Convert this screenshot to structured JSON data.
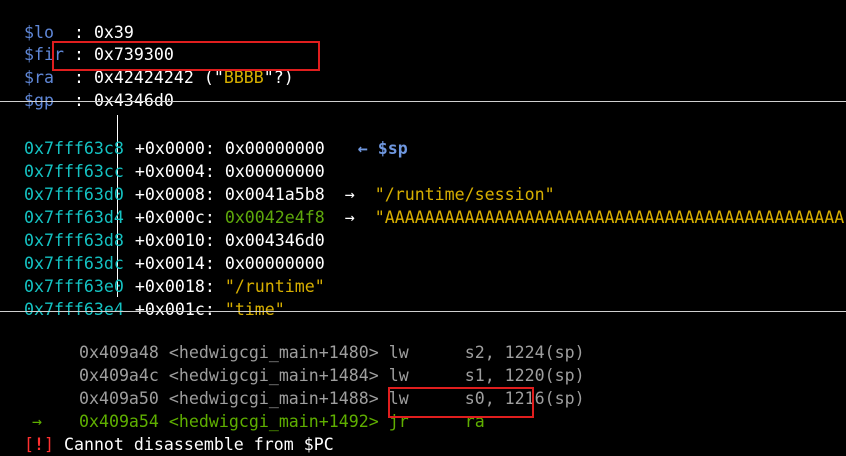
{
  "registers": [
    {
      "name": "$lo",
      "sep": "  : ",
      "value": "0x39"
    },
    {
      "name": "$fir",
      "sep": " : ",
      "value": "0x739300"
    },
    {
      "name": "$ra",
      "sep": "  : ",
      "value": "0x42424242",
      "deref_open": " (\"",
      "deref_str": "BBBB",
      "deref_close": "\"?)"
    },
    {
      "name": "$gp",
      "sep": "  : ",
      "value": "0x4346d0"
    }
  ],
  "stack": [
    {
      "addr": "0x7fff63c8",
      "offset": "+0x0000:",
      "value": "0x00000000",
      "arrow": "←",
      "note": "$sp"
    },
    {
      "addr": "0x7fff63cc",
      "offset": "+0x0004:",
      "value": "0x00000000"
    },
    {
      "addr": "0x7fff63d0",
      "offset": "+0x0008:",
      "value": "0x0041a5b8",
      "arrow": "→",
      "note": "\"/runtime/session\""
    },
    {
      "addr": "0x7fff63d4",
      "offset": "+0x000c:",
      "value": "0x0042e4f8",
      "arrow": "→",
      "note": "\"AAAAAAAAAAAAAAAAAAAAAAAAAAAAAAAAAAAAAAAAAAAAAA"
    },
    {
      "addr": "0x7fff63d8",
      "offset": "+0x0010:",
      "value": "0x004346d0"
    },
    {
      "addr": "0x7fff63dc",
      "offset": "+0x0014:",
      "value": "0x00000000"
    },
    {
      "addr": "0x7fff63e0",
      "offset": "+0x0018:",
      "value": "\"/runtime\""
    },
    {
      "addr": "0x7fff63e4",
      "offset": "+0x001c:",
      "value": "\"time\""
    }
  ],
  "disasm": [
    {
      "marker": "",
      "addr": "0x409a48",
      "sym": "<hedwigcgi_main+1480>",
      "mnem": "lw",
      "ops": "s2, 1224(sp)"
    },
    {
      "marker": "",
      "addr": "0x409a4c",
      "sym": "<hedwigcgi_main+1484>",
      "mnem": "lw",
      "ops": "s1, 1220(sp)"
    },
    {
      "marker": "",
      "addr": "0x409a50",
      "sym": "<hedwigcgi_main+1488>",
      "mnem": "lw",
      "ops": "s0, 1216(sp)"
    },
    {
      "marker": "→",
      "addr": "0x409a54",
      "sym": "<hedwigcgi_main+1492>",
      "mnem": "jr",
      "ops": "ra"
    }
  ],
  "error": {
    "tag_open": "[",
    "tag_mark": "!",
    "tag_close": "]",
    "message": " Cannot disassemble from $PC"
  },
  "colors": {
    "background": "#000000",
    "register_name": "#5f87d7",
    "address": "#14c2c2",
    "string": "#d7af00",
    "current_instruction": "#5faf00",
    "past_instruction": "#9e9e9e",
    "error": "#ff3030",
    "highlight_box": "#e01e1e"
  }
}
